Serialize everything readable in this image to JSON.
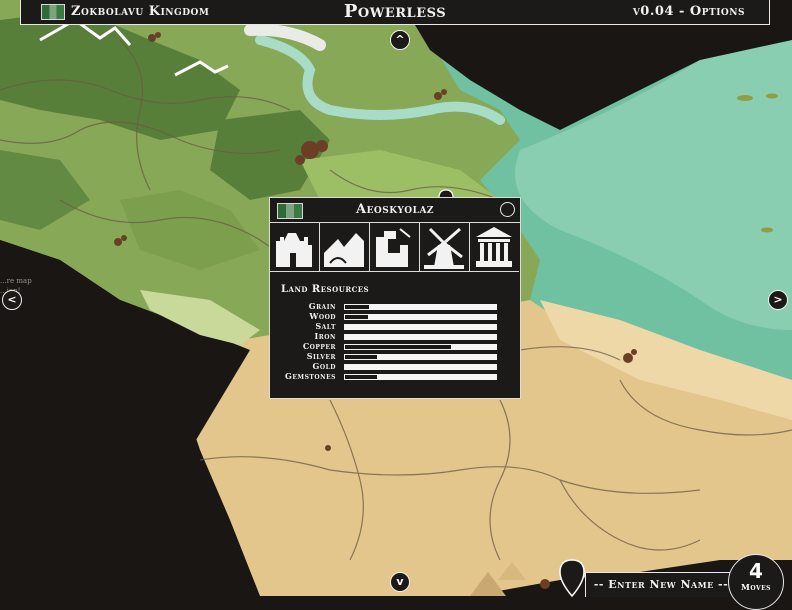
{
  "topbar": {
    "kingdom_name": "Zokbolavu Kingdom",
    "title": "Powerless",
    "version_options": "v0.04 - Options"
  },
  "nav": {
    "up": "^",
    "down": "v",
    "left": "<",
    "right": ">"
  },
  "region_panel": {
    "name": "Aeoskyolaz",
    "buildings": [
      "castle-icon",
      "sawmill-icon",
      "mine-tower-icon",
      "windmill-icon",
      "temple-icon"
    ],
    "resources_title": "Land Resources",
    "resources": [
      {
        "label": "Grain",
        "level": 0.16
      },
      {
        "label": "Wood",
        "level": 0.15
      },
      {
        "label": "Salt",
        "level": 0.0
      },
      {
        "label": "Iron",
        "level": 0.0
      },
      {
        "label": "Copper",
        "level": 0.7
      },
      {
        "label": "Silver",
        "level": 0.21
      },
      {
        "label": "Gold",
        "level": 0.0
      },
      {
        "label": "Gemstones",
        "level": 0.21
      }
    ]
  },
  "map_hint": "...re map\n...ion!",
  "name_input": {
    "placeholder": "-- Enter New Name --"
  },
  "moves": {
    "count": "4",
    "label": "Moves"
  },
  "colors": {
    "water": "#6fc1a1",
    "grassland": "#7fa352",
    "forest": "#4f7a36",
    "desert": "#e2c68b",
    "void": "#1a1614",
    "ui_dark": "#1c1a19"
  }
}
